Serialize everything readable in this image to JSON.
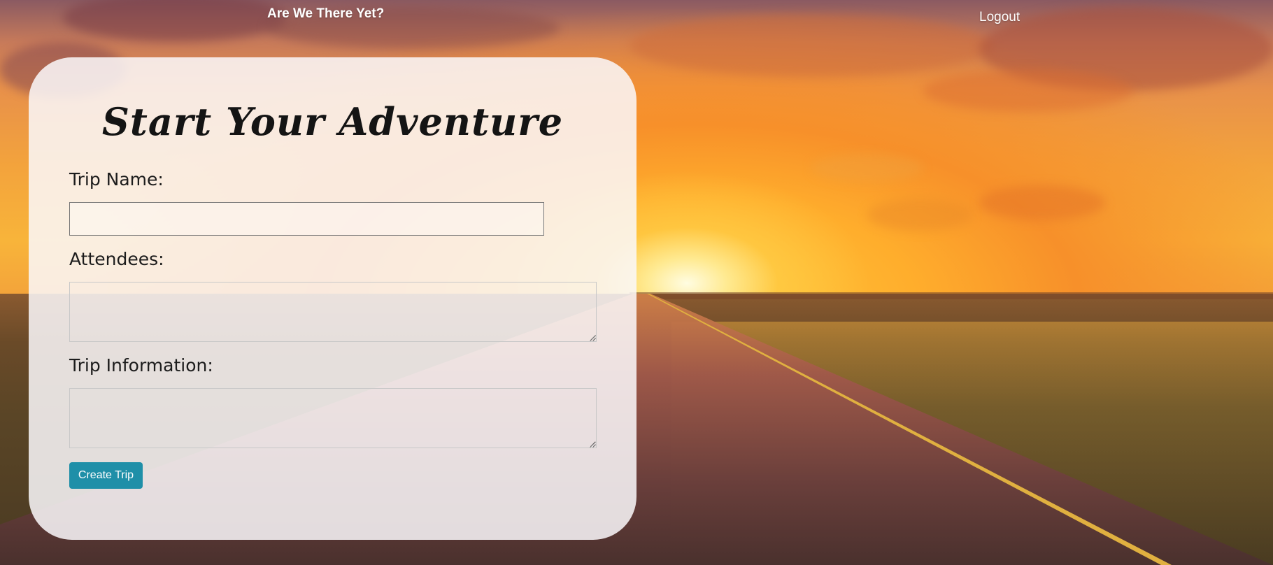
{
  "nav": {
    "brand": "Are We There Yet?",
    "logout": "Logout"
  },
  "form": {
    "title": "Start Your Adventure",
    "trip_name_label": "Trip Name:",
    "trip_name_value": "",
    "attendees_label": "Attendees:",
    "attendees_value": "",
    "trip_info_label": "Trip Information:",
    "trip_info_value": "",
    "submit_label": "Create Trip"
  },
  "colors": {
    "button": "#1f8fa8",
    "card": "#faf8fa",
    "nav_text": "#ffffff"
  }
}
